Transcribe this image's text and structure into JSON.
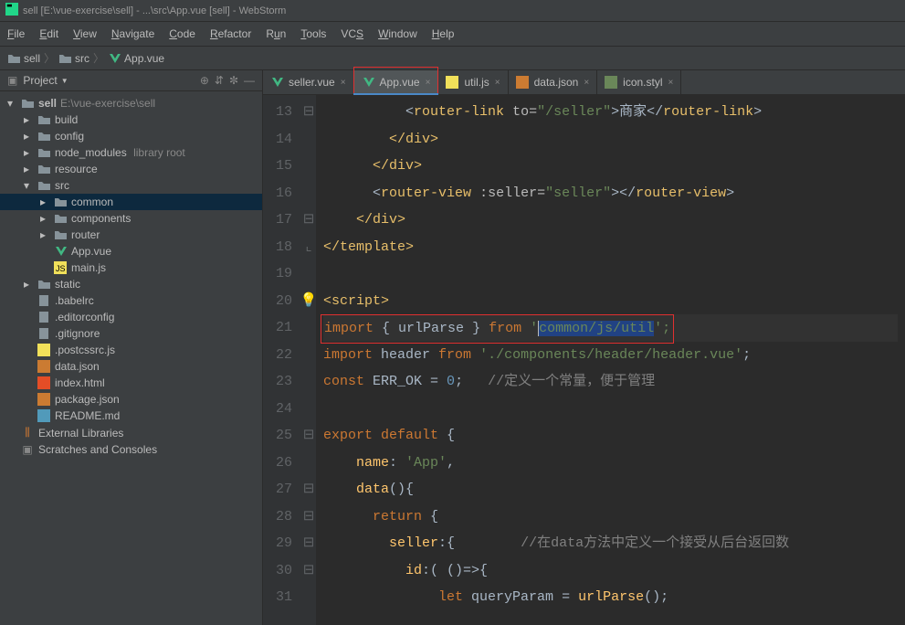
{
  "title": "sell [E:\\vue-exercise\\sell] - ...\\src\\App.vue [sell] - WebStorm",
  "menu": [
    "File",
    "Edit",
    "View",
    "Navigate",
    "Code",
    "Refactor",
    "Run",
    "Tools",
    "VCS",
    "Window",
    "Help"
  ],
  "breadcrumb": {
    "root": "sell",
    "folder": "src",
    "file": "App.vue"
  },
  "sidebar": {
    "project_label": "Project",
    "nodes": {
      "sell": "sell",
      "sell_path": "E:\\vue-exercise\\sell",
      "build": "build",
      "config": "config",
      "node_modules": "node_modules",
      "library_root": "library root",
      "resource": "resource",
      "src": "src",
      "common": "common",
      "components": "components",
      "router": "router",
      "appvue": "App.vue",
      "mainjs": "main.js",
      "static": "static",
      "babelrc": ".babelrc",
      "editorconfig": ".editorconfig",
      "gitignore": ".gitignore",
      "postcssrc": ".postcssrc.js",
      "datajson": "data.json",
      "indexhtml": "index.html",
      "packagejson": "package.json",
      "readme": "README.md",
      "extlib": "External Libraries",
      "scratches": "Scratches and Consoles"
    }
  },
  "tabs": [
    {
      "label": "seller.vue",
      "type": "vue"
    },
    {
      "label": "App.vue",
      "type": "vue",
      "active": true,
      "highlight": true
    },
    {
      "label": "util.js",
      "type": "js"
    },
    {
      "label": "data.json",
      "type": "json"
    },
    {
      "label": "icon.styl",
      "type": "styl"
    }
  ],
  "code": {
    "l13": {
      "pre": "          <",
      "tag": "router-link",
      "attr": " to=",
      "val": "\"/seller\"",
      "mid": ">商家</",
      "tag2": "router-link",
      "end": ">"
    },
    "l14": "        </div>",
    "l15": "      </div>",
    "l16": {
      "pre": "      <",
      "tag": "router-view",
      "attr": " :seller=",
      "val": "\"seller\"",
      "mid": "></",
      "tag2": "router-view",
      "end": ">"
    },
    "l17": "    </div>",
    "l18": "</template>",
    "l19": "",
    "l20": "<script>",
    "l21_import": "import",
    "l21_brace": " { ",
    "l21_name": "urlParse",
    "l21_brace2": " } ",
    "l21_from": "from",
    "l21_sp": " ",
    "l21_q": "'",
    "l21_path": "common/js/util",
    "l21_end": "';",
    "l22_import": "import",
    "l22_name": " header ",
    "l22_from": "from",
    "l22_str": " './components/header/header.vue'",
    "l22_end": ";",
    "l23_const": "const",
    "l23_name": " ERR_OK = ",
    "l23_num": "0",
    "l23_end": ";",
    "l23_comment": "   //定义一个常量，便于管理",
    "l24": "",
    "l25_export": "export default",
    "l25_brace": " {",
    "l26_name": "    name",
    "l26_colon": ": ",
    "l26_str": "'App'",
    "l26_end": ",",
    "l27_name": "    data",
    "l27_paren": "()",
    "l27_brace": "{",
    "l28_ret": "      return",
    "l28_brace": " {",
    "l29_name": "        seller",
    "l29_colon": ":{",
    "l29_comment": "        //在data方法中定义一个接受从后台返回数",
    "l30_name": "          id",
    "l30_colon": ":( ()=>{",
    "l31_let": "              let",
    "l31_name": " queryParam = ",
    "l31_fn": "urlParse",
    "l31_end": "();"
  },
  "line_numbers": [
    "13",
    "14",
    "15",
    "16",
    "17",
    "18",
    "19",
    "20",
    "21",
    "22",
    "23",
    "24",
    "25",
    "26",
    "27",
    "28",
    "29",
    "30",
    "31"
  ]
}
